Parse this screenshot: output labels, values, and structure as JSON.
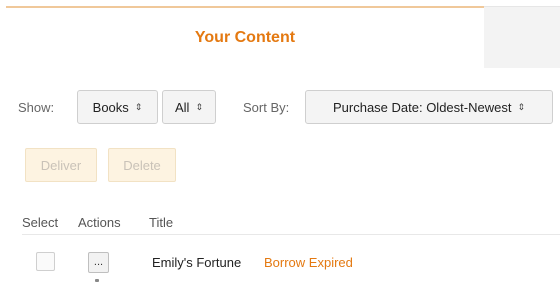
{
  "tabs": {
    "active": "Your Content",
    "inactive": ""
  },
  "filters": {
    "show_label": "Show:",
    "category": "Books",
    "subset": "All",
    "sort_label": "Sort By:",
    "sort_value": "Purchase Date: Oldest-Newest"
  },
  "actions": {
    "deliver": "Deliver",
    "delete": "Delete"
  },
  "table": {
    "headers": {
      "select": "Select",
      "actions": "Actions",
      "title": "Title"
    },
    "rows": [
      {
        "more": "...",
        "title": "Emily's Fortune",
        "status": "Borrow Expired"
      }
    ]
  },
  "colors": {
    "accent_orange": "#e47911",
    "disabled_button_bg": "#fdf3e1",
    "tab_border": "#f0c89a"
  },
  "icons": {
    "select_chevron": "updown-chevron-icon",
    "row_menu": "more-options-icon"
  }
}
